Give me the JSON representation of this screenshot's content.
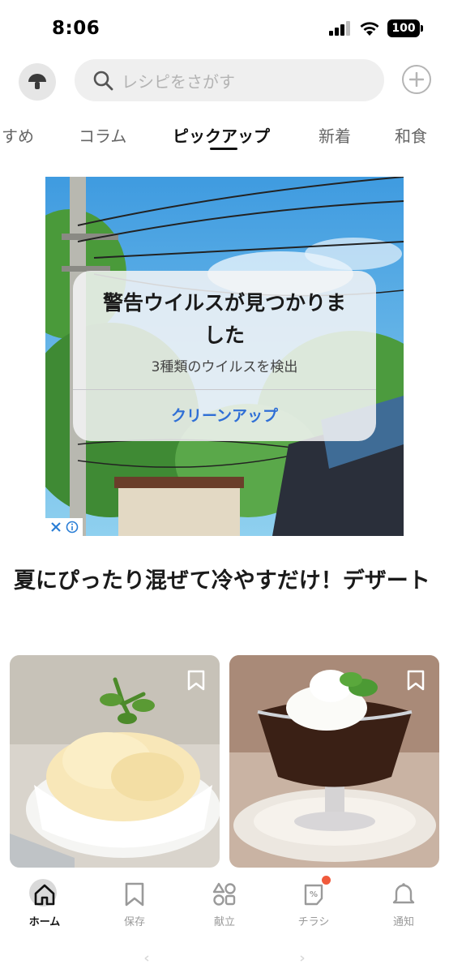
{
  "status_bar": {
    "time": "8:06",
    "battery": "100"
  },
  "header": {
    "avatar_icon": "mushroom-icon",
    "search_placeholder": "レシピをさがす",
    "search_icon": "search-icon",
    "add_icon": "plus-circle-icon"
  },
  "tabs": {
    "items": [
      "すめ",
      "コラム",
      "ピックアップ",
      "新着",
      "和食"
    ],
    "active": "ピックアップ"
  },
  "ad": {
    "dialog_title": "警告ウイルスが見つかりました",
    "dialog_subtitle": "3種類のウイルスを検出",
    "dialog_button": "クリーンアップ",
    "close_icon": "close-icon",
    "info_icon": "info-icon"
  },
  "section": {
    "title": "夏にぴったり混ぜて冷やすだけ！デザート"
  },
  "cards": [
    {
      "image": "vanilla-ice-cream-photo",
      "bookmark_icon": "bookmark-icon"
    },
    {
      "image": "coffee-jelly-photo",
      "bookmark_icon": "bookmark-icon"
    }
  ],
  "bottom_nav": {
    "items": [
      {
        "label": "ホーム",
        "icon": "home-icon",
        "active": true
      },
      {
        "label": "保存",
        "icon": "bookmark-icon",
        "active": false
      },
      {
        "label": "献立",
        "icon": "menu-grid-icon",
        "active": false
      },
      {
        "label": "チラシ",
        "icon": "flyer-icon",
        "active": false,
        "badge": true
      },
      {
        "label": "通知",
        "icon": "bell-icon",
        "active": false
      }
    ]
  },
  "colors": {
    "accent_link": "#2f6fd6",
    "badge_dot": "#f05a3c",
    "sky": "#4fa3d9"
  }
}
